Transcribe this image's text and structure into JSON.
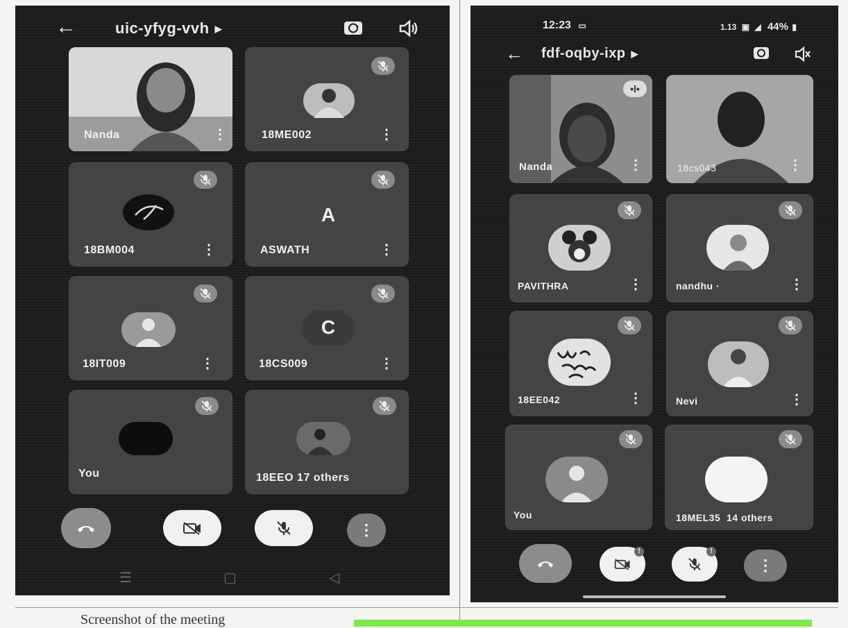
{
  "left_phone": {
    "meeting_code": "uic-yfyg-vvh",
    "back_icon": "arrow-left-icon",
    "caret_icon": "caret-right-icon",
    "camera_switch_icon": "switch-camera-icon",
    "audio_icon": "speaker-icon",
    "tiles": [
      {
        "name": "Nanda",
        "kind": "video"
      },
      {
        "name": "18ME002",
        "kind": "photo"
      },
      {
        "name": "18BM004",
        "kind": "photo"
      },
      {
        "name": "ASWATH",
        "kind": "letter",
        "letter": "A"
      },
      {
        "name": "18IT009",
        "kind": "default"
      },
      {
        "name": "18CS009",
        "kind": "letter",
        "letter": "C"
      },
      {
        "name": "You",
        "kind": "dark"
      },
      {
        "name": "18EEO",
        "kind": "photo",
        "extra": "17 others"
      }
    ],
    "controls": [
      "end-call-icon",
      "camera-off-icon",
      "mic-off-icon",
      "more-vert-icon"
    ],
    "nav": [
      "menu-icon",
      "home-icon",
      "back-triangle-icon"
    ]
  },
  "right_phone": {
    "status_time": "12:23",
    "status_battery": "44%",
    "status_net": "1.13",
    "meeting_code": "fdf-oqby-ixp",
    "back_icon": "arrow-left-icon",
    "caret_icon": "caret-right-icon",
    "camera_switch_icon": "switch-camera-icon",
    "audio_icon": "speaker-off-icon",
    "tiles": [
      {
        "name": "Nanda",
        "kind": "video"
      },
      {
        "name": "18cs043",
        "kind": "video"
      },
      {
        "name": "PAVITHRA",
        "kind": "photo"
      },
      {
        "name": "nandhu ·",
        "kind": "photo"
      },
      {
        "name": "18EE042",
        "kind": "photo"
      },
      {
        "name": "Nevi",
        "kind": "photo"
      },
      {
        "name": "You",
        "kind": "default"
      },
      {
        "name": "18MEL35",
        "kind": "white",
        "extra": "14 others"
      }
    ],
    "badge": "!",
    "controls": [
      "end-call-icon",
      "camera-off-icon",
      "mic-off-icon",
      "more-vert-icon"
    ]
  },
  "caption": "Screenshot of the meeting"
}
